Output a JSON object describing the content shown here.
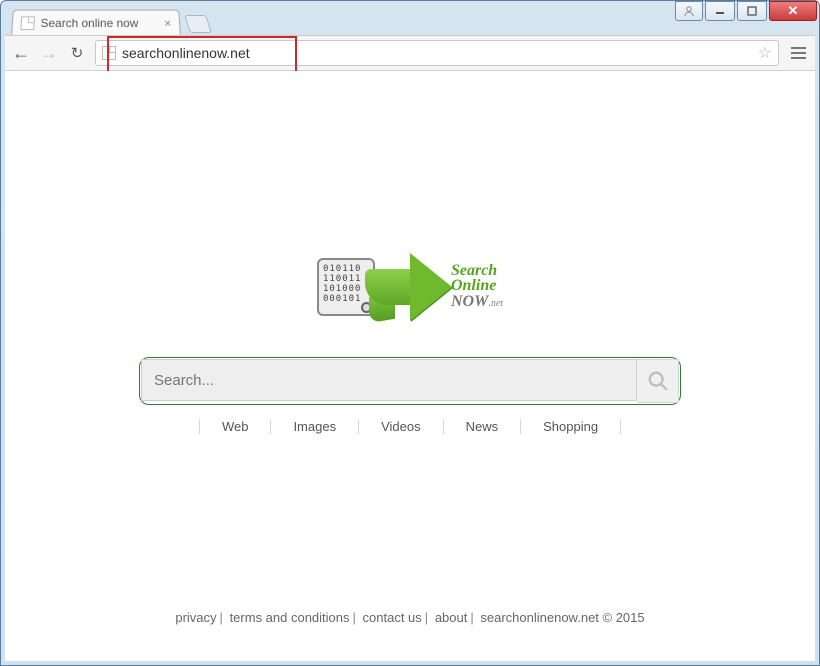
{
  "window": {
    "tab_title": "Search online now"
  },
  "toolbar": {
    "url": "searchonlinenow.net"
  },
  "logo": {
    "line1": "Search",
    "line2": "Online",
    "line3": "NOW",
    "suffix": ".net",
    "binary": "010110\n110011\n101000\n000101"
  },
  "search": {
    "placeholder": "Search..."
  },
  "categories": [
    "Web",
    "Images",
    "Videos",
    "News",
    "Shopping"
  ],
  "footer": {
    "links": [
      "privacy",
      "terms and conditions",
      "contact us",
      "about"
    ],
    "copyright": "searchonlinenow.net © 2015"
  }
}
